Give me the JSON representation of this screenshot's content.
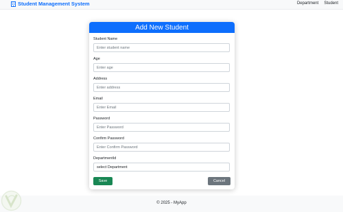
{
  "navbar": {
    "brand": "Student Management System",
    "links": [
      "Department",
      "Student"
    ]
  },
  "form": {
    "title": "Add New Student",
    "fields": [
      {
        "label": "Student Name",
        "placeholder": "Enter student name"
      },
      {
        "label": "Age",
        "placeholder": "Enter age"
      },
      {
        "label": "Address",
        "placeholder": "Enter address"
      },
      {
        "label": "Email",
        "placeholder": "Enter Email"
      },
      {
        "label": "Password",
        "placeholder": "Enter Password"
      },
      {
        "label": "Confirm Password",
        "placeholder": "Enter Confirm Password"
      }
    ],
    "department": {
      "label": "DepartmentId",
      "selected": "select Department"
    },
    "save_label": "Save",
    "cancel_label": "Cancel"
  },
  "footer": {
    "text": "© 2025 - MyApp"
  },
  "colors": {
    "primary": "#0d6efd",
    "success": "#198754",
    "secondary": "#6c757d",
    "light": "#f8f9fa"
  },
  "icons": {
    "brand": "building-icon",
    "watermark": "watermark-logo-icon"
  }
}
